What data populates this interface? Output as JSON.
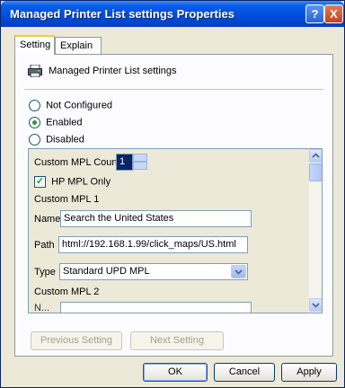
{
  "window": {
    "title": "Managed Printer List settings Properties",
    "help_glyph": "?",
    "close_glyph": "X"
  },
  "tabs": [
    {
      "label": "Setting"
    },
    {
      "label": "Explain"
    }
  ],
  "setting": {
    "name": "Managed Printer List settings",
    "icon": "printer-policy-icon",
    "state_options": [
      {
        "label": "Not Configured",
        "selected": false
      },
      {
        "label": "Enabled",
        "selected": true
      },
      {
        "label": "Disabled",
        "selected": false
      }
    ]
  },
  "options": {
    "mpl_count_label": "Custom MPL Count",
    "mpl_count_value": "1",
    "hp_mpl_only_label": "HP MPL Only",
    "hp_mpl_only_checked": true,
    "mpl1_heading": "Custom MPL 1",
    "name_label": "Name",
    "name_value": "Search the United States",
    "path_label": "Path",
    "path_value": "html://192.168.1.99/click_maps/US.html",
    "type_label": "Type",
    "type_value": "Standard UPD MPL",
    "mpl2_heading": "Custom MPL 2",
    "partial_label": "N..."
  },
  "navigation": {
    "previous": "Previous Setting",
    "next": "Next Setting"
  },
  "footer": {
    "ok": "OK",
    "cancel": "Cancel",
    "apply": "Apply"
  },
  "colors": {
    "title_bar": "#0050e0",
    "dialog_bg": "#ece9d8",
    "accent_tab": "#ffc83c",
    "radio_dot": "#21a121"
  }
}
